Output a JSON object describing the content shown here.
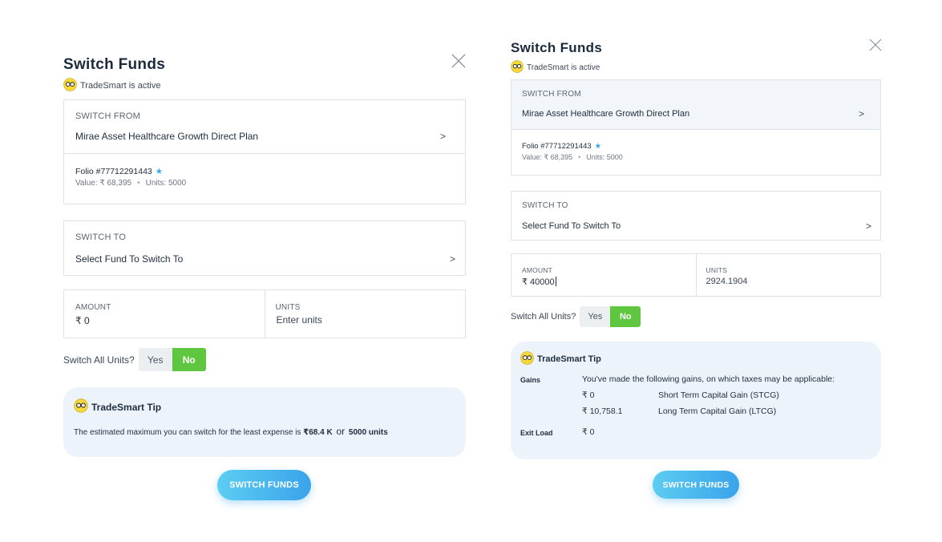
{
  "left": {
    "title": "Switch Funds",
    "tradesmart_status": "TradeSmart is active",
    "switch_from": {
      "label": "SWITCH FROM",
      "fund": "Mirae Asset Healthcare Growth Direct Plan",
      "chevron": ">"
    },
    "folio": {
      "number": "Folio #77712291443",
      "star": "★",
      "value": "Value: ₹ 68,395",
      "units": "Units: 5000",
      "sep": "•"
    },
    "switch_to": {
      "label": "SWITCH TO",
      "placeholder": "Select Fund To Switch To",
      "chevron": ">"
    },
    "amount": {
      "label": "AMOUNT",
      "value": "₹ 0"
    },
    "units": {
      "label": "UNITS",
      "placeholder": "Enter units"
    },
    "switch_all": {
      "label": "Switch All Units?",
      "yes": "Yes",
      "no": "No",
      "selected": "No"
    },
    "tip": {
      "title": "TradeSmart Tip",
      "text_prefix": "The estimated maximum you can switch for the least expense is ",
      "max_amount": "₹68.4 K",
      "or": "or",
      "max_units": "5000 units"
    },
    "cta": "SWITCH FUNDS"
  },
  "right": {
    "title": "Switch Funds",
    "tradesmart_status": "TradeSmart is active",
    "switch_from": {
      "label": "SWITCH FROM",
      "fund": "Mirae Asset Healthcare Growth Direct Plan",
      "chevron": ">"
    },
    "folio": {
      "number": "Folio #77712291443",
      "star": "★",
      "value": "Value: ₹ 68,395",
      "units": "Units: 5000",
      "sep": "•"
    },
    "switch_to": {
      "label": "SWITCH TO",
      "placeholder": "Select Fund To Switch To",
      "chevron": ">"
    },
    "amount": {
      "label": "AMOUNT",
      "value": "₹ 40000"
    },
    "units": {
      "label": "UNITS",
      "value": "2924.1904"
    },
    "switch_all": {
      "label": "Switch All Units?",
      "yes": "Yes",
      "no": "No",
      "selected": "No"
    },
    "tip": {
      "title": "TradeSmart Tip",
      "gains_label": "Gains",
      "gains_intro": "You've made the following gains, on which taxes may be applicable:",
      "stcg_value": "₹ 0",
      "stcg_label": "Short Term Capital Gain (STCG)",
      "ltcg_value": "₹ 10,758.1",
      "ltcg_label": "Long Term Capital Gain (LTCG)",
      "exit_load_label": "Exit Load",
      "exit_load_value": "₹ 0"
    },
    "cta": "SWITCH FUNDS"
  },
  "colors": {
    "accent_green": "#5ec63f",
    "cta_blue": "#3aa3eb",
    "tip_bg": "#edf3fb",
    "star_blue": "#3aa7e3",
    "glasses_yellow": "#f7d93a"
  },
  "icons": {
    "close": "close-icon",
    "tradesmart": "glasses-icon",
    "chevron": "chevron-right-icon",
    "star": "star-icon"
  }
}
